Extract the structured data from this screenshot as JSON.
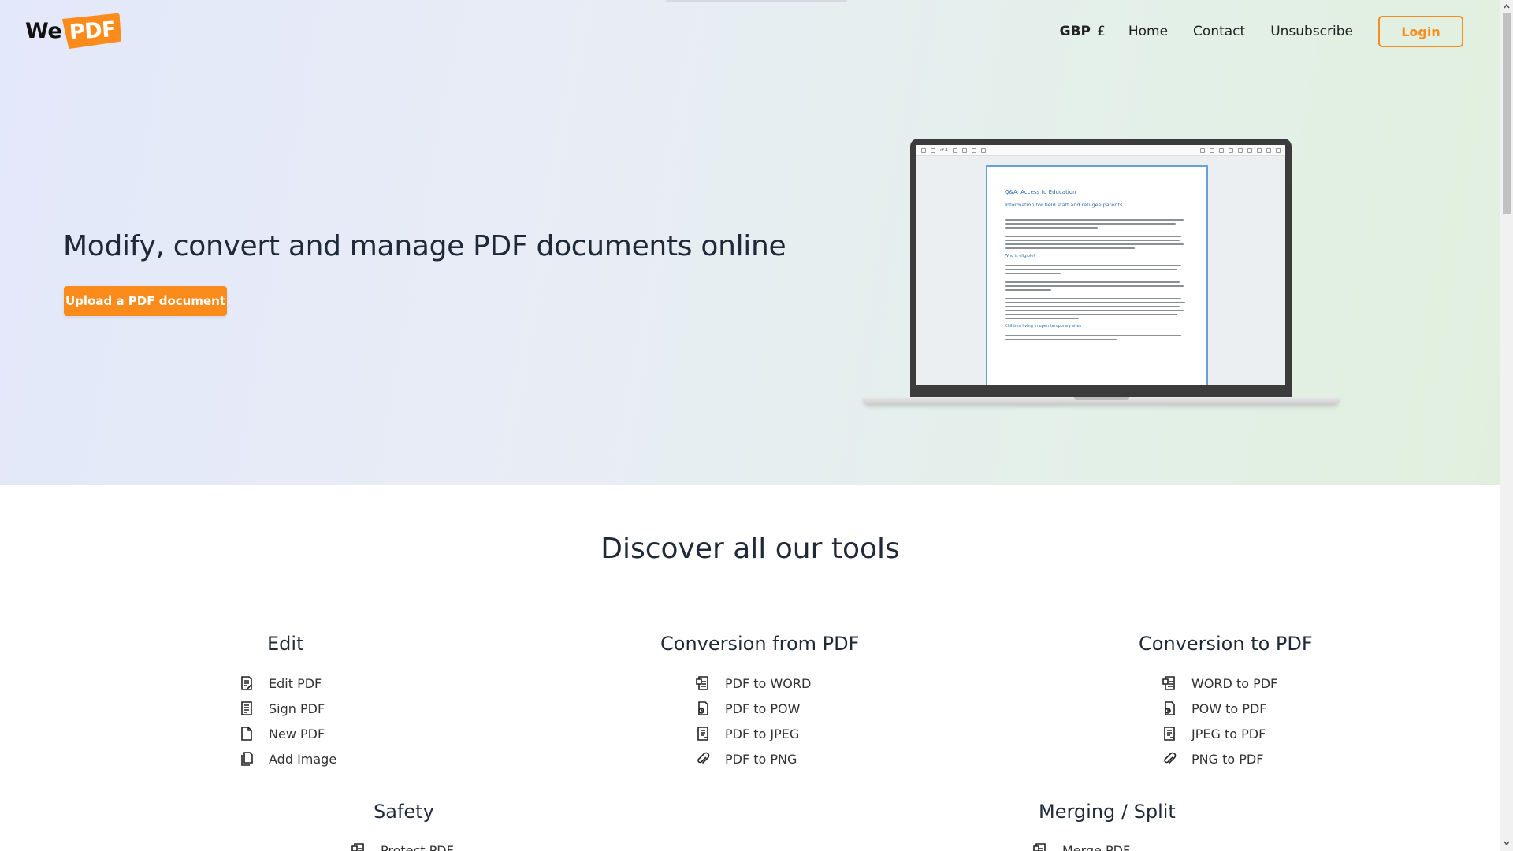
{
  "header": {
    "logo_we": "We",
    "logo_pdf": "PDF",
    "currency_code": "GBP",
    "currency_symbol": "£",
    "nav": [
      "Home",
      "Contact",
      "Unsubscribe"
    ],
    "login_label": "Login"
  },
  "hero": {
    "title": "Modify, convert and manage PDF documents online",
    "upload_label": "Upload a PDF document",
    "viewer": {
      "page_counter": "of 4",
      "doc_title": "Q&A: Access to Education",
      "doc_subtitle": "Information for field staff and refugee parents",
      "section_1": "Who is eligible?",
      "section_2": "Children living in open temporary sites"
    }
  },
  "tools": {
    "title": "Discover all our tools",
    "categories": [
      {
        "title": "Edit",
        "items": [
          {
            "label": "Edit PDF",
            "icon": "edit-document-icon"
          },
          {
            "label": "Sign PDF",
            "icon": "sign-document-icon"
          },
          {
            "label": "New PDF",
            "icon": "new-document-icon"
          },
          {
            "label": "Add Image",
            "icon": "copy-document-icon"
          }
        ]
      },
      {
        "title": "Conversion from PDF",
        "items": [
          {
            "label": "PDF to WORD",
            "icon": "word-document-icon"
          },
          {
            "label": "PDF to POW",
            "icon": "powerpoint-document-icon"
          },
          {
            "label": "PDF to JPEG",
            "icon": "image-document-icon"
          },
          {
            "label": "PDF to PNG",
            "icon": "paperclip-icon"
          }
        ]
      },
      {
        "title": "Conversion to PDF",
        "items": [
          {
            "label": "WORD to PDF",
            "icon": "word-document-icon"
          },
          {
            "label": "POW to PDF",
            "icon": "powerpoint-document-icon"
          },
          {
            "label": "JPEG to PDF",
            "icon": "image-document-icon"
          },
          {
            "label": "PNG to PDF",
            "icon": "paperclip-icon"
          }
        ]
      },
      {
        "title": "Safety",
        "items": [
          {
            "label": "Protect PDF",
            "icon": "lock-document-icon"
          }
        ]
      },
      {
        "title": "Merging / Split",
        "items": [
          {
            "label": "Merge PDF",
            "icon": "merge-document-icon"
          }
        ]
      }
    ]
  },
  "colors": {
    "accent": "#fb8c1c",
    "link_blue": "#2b6cb0"
  }
}
